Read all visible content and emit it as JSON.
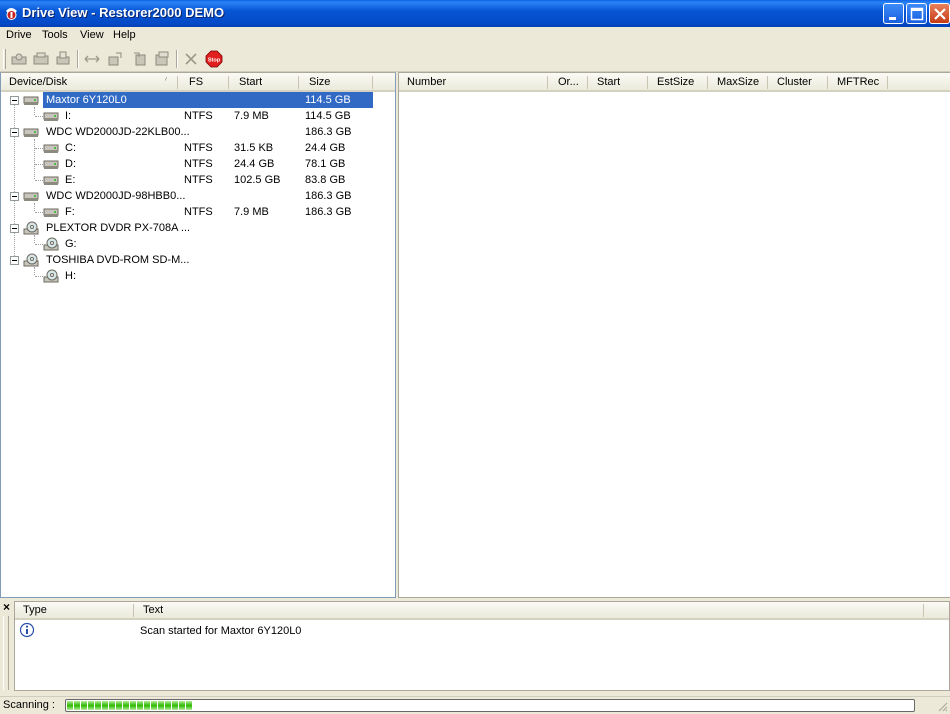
{
  "window": {
    "title": "Drive View - Restorer2000 DEMO"
  },
  "menu": [
    "Drive",
    "Tools",
    "View",
    "Help"
  ],
  "toolbar": {
    "buttons": [
      "open-disk-icon",
      "save-icon",
      "print-icon",
      "swap-icon",
      "export-icon",
      "import-icon",
      "copy-icon",
      "delete-icon",
      "stop-icon"
    ],
    "stop_label": "Stop"
  },
  "left_pane": {
    "columns": [
      "Device/Disk",
      "FS",
      "Start",
      "Size"
    ],
    "rows": [
      {
        "name": "Maxtor 6Y120L0",
        "fs": "",
        "start": "",
        "size": "114.5 GB",
        "level": 0,
        "type": "hdd",
        "selected": true
      },
      {
        "name": "I:",
        "fs": "NTFS",
        "start": "7.9 MB",
        "size": "114.5 GB",
        "level": 1,
        "type": "partition"
      },
      {
        "name": "WDC WD2000JD-22KLB00...",
        "fs": "",
        "start": "",
        "size": "186.3 GB",
        "level": 0,
        "type": "hdd"
      },
      {
        "name": "C:",
        "fs": "NTFS",
        "start": "31.5 KB",
        "size": "24.4 GB",
        "level": 1,
        "type": "partition"
      },
      {
        "name": "D:",
        "fs": "NTFS",
        "start": "24.4 GB",
        "size": "78.1 GB",
        "level": 1,
        "type": "partition"
      },
      {
        "name": "E:",
        "fs": "NTFS",
        "start": "102.5 GB",
        "size": "83.8 GB",
        "level": 1,
        "type": "partition"
      },
      {
        "name": "WDC WD2000JD-98HBB0...",
        "fs": "",
        "start": "",
        "size": "186.3 GB",
        "level": 0,
        "type": "hdd"
      },
      {
        "name": "F:",
        "fs": "NTFS",
        "start": "7.9 MB",
        "size": "186.3 GB",
        "level": 1,
        "type": "partition"
      },
      {
        "name": "PLEXTOR DVDR PX-708A ...",
        "fs": "",
        "start": "",
        "size": "",
        "level": 0,
        "type": "cdrom"
      },
      {
        "name": "G:",
        "fs": "",
        "start": "",
        "size": "",
        "level": 1,
        "type": "cd"
      },
      {
        "name": "TOSHIBA DVD-ROM SD-M...",
        "fs": "",
        "start": "",
        "size": "",
        "level": 0,
        "type": "cdrom"
      },
      {
        "name": "H:",
        "fs": "",
        "start": "",
        "size": "",
        "level": 1,
        "type": "cd"
      }
    ]
  },
  "right_pane": {
    "columns": [
      "Number",
      "Or...",
      "Start",
      "EstSize",
      "MaxSize",
      "Cluster",
      "MFTRec"
    ]
  },
  "log": {
    "close_label": "×",
    "columns": [
      "Type",
      "Text"
    ],
    "entries": [
      {
        "type_icon": "info-icon",
        "text": "Scan started for Maxtor 6Y120L0"
      }
    ]
  },
  "status": {
    "label": "Scanning :",
    "progress": 0.155
  },
  "colors": {
    "titlebar": "#0451d0",
    "selection": "#316ac5",
    "progress": "#2fb800",
    "stop": "#e01f1f"
  }
}
